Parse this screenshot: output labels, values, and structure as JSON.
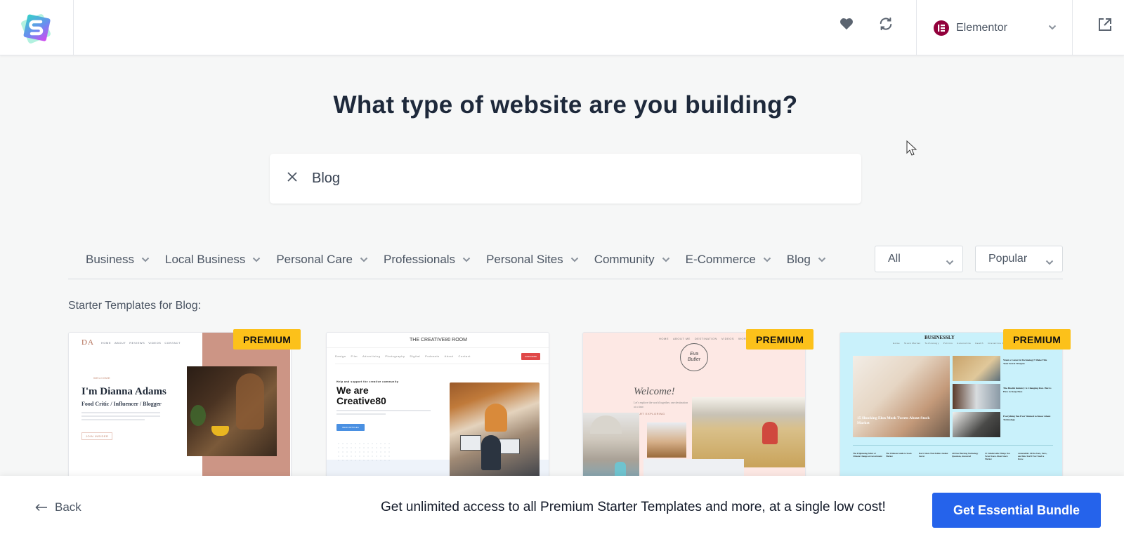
{
  "header": {
    "logo_name": "Starter Templates",
    "favorites_icon": "heart-icon",
    "sync_icon": "sync-icon",
    "page_builder": {
      "label": "Elementor",
      "badge_color": "#92003b"
    },
    "external_icon": "external-link-icon"
  },
  "main": {
    "title": "What type of website are you building?",
    "search": {
      "value": "Blog",
      "placeholder": ""
    },
    "categories": [
      {
        "label": "Business"
      },
      {
        "label": "Local Business"
      },
      {
        "label": "Personal Care"
      },
      {
        "label": "Professionals"
      },
      {
        "label": "Personal Sites"
      },
      {
        "label": "Community"
      },
      {
        "label": "E-Commerce"
      },
      {
        "label": "Blog"
      }
    ],
    "type_filter": {
      "selected": "All"
    },
    "sort_filter": {
      "selected": "Popular"
    },
    "section_label": "Starter Templates for Blog:",
    "templates": [
      {
        "name": "Dianna Adams",
        "premium": true,
        "badge": "PREMIUM",
        "preview": {
          "logo": "DA",
          "nav": [
            "HOME",
            "ABOUT",
            "REVIEWS",
            "VIDEOS",
            "CONTACT"
          ],
          "eyebrow": "WELCOME",
          "heading": "I'm Dianna Adams",
          "subheading": "Food Critic / Influencer / Blogger",
          "button": "JOIN INSIDER"
        }
      },
      {
        "name": "Creative80",
        "premium": false,
        "badge": "",
        "preview": {
          "site_title": "THE CREATIVE80 ROOM",
          "nav": [
            "Design",
            "Film",
            "Advertising",
            "Photography",
            "Digital",
            "Podcasts",
            "About",
            "Contact"
          ],
          "cta": "SUBSCRIBE",
          "eyebrow": "Help and support the creative community",
          "heading_line1": "We are",
          "heading_line2": "Creative80",
          "button": "READ ARTICLES"
        }
      },
      {
        "name": "Eva Butler Travel",
        "premium": true,
        "badge": "PREMIUM",
        "preview": {
          "nav": [
            "HOME",
            "ABOUT ME",
            "DESTINATION",
            "VIDEOS",
            "WORK WITH ME"
          ],
          "logo_line1": "Eva",
          "logo_line2": "Butler",
          "heading": "Welcome!",
          "text": "Let's explore the world together, one destination at a time.",
          "link": "START EXPLORING"
        }
      },
      {
        "name": "Businessly",
        "premium": true,
        "badge": "PREMIUM",
        "preview": {
          "site_title": "BUSINESSLY",
          "nav": [
            "Home",
            "Stock Market",
            "Technology",
            "Politics",
            "Automobile",
            "Health",
            "Interactive Design"
          ],
          "hero_title": "15 Shocking Elon Musk Tweets About Stock Market",
          "side_posts": [
            "Want a Career in Technology? Make This Your Secret Weapon",
            "The Health Industry Is Changing Fast. Here's How to Keep Pace",
            "Everything You Ever Wanted to Know About Technology"
          ],
          "bottom_posts": [
            "The Frightening Affect of Climate Change on Government",
            "The Ultimate Guide to Stock Market",
            "Don't Share This Politics Insider Secret",
            "All Your Burning Technology Questions, Answered",
            "15 Unbelievable Things You Never Knew About Stock Market",
            "Automobile: All the Stats, Facts, and Data You'll Ever Need to Know"
          ]
        }
      }
    ]
  },
  "footer": {
    "back_label": "Back",
    "promo_text": "Get unlimited access to all Premium Starter Templates and more, at a single low cost!",
    "cta_label": "Get Essential Bundle",
    "cta_color": "#2563eb"
  }
}
